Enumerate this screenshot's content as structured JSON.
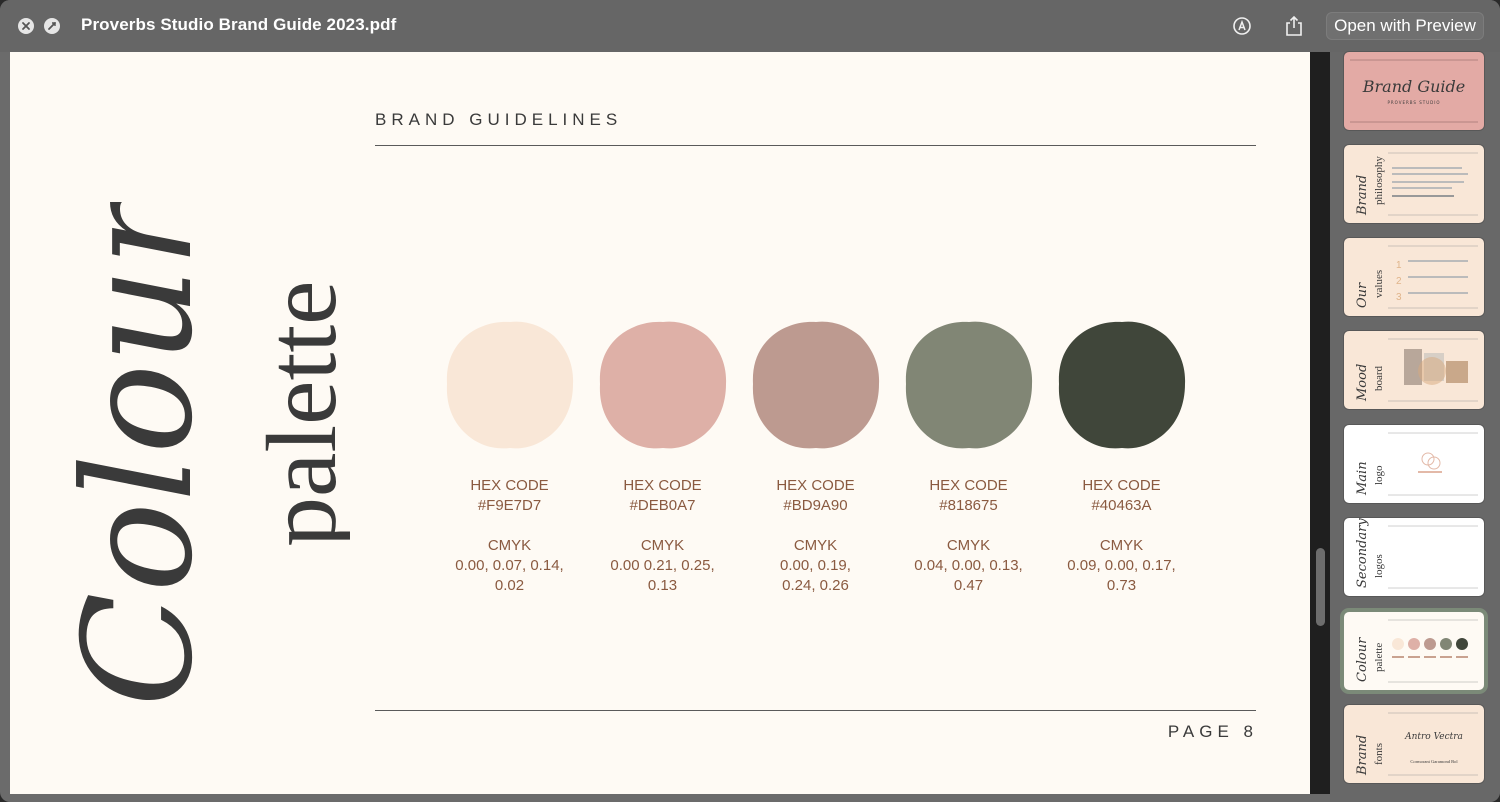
{
  "window": {
    "title": "Proverbs Studio Brand Guide 2023.pdf",
    "open_with_label": "Open with Preview"
  },
  "page": {
    "heading": "BRAND GUIDELINES",
    "title_script_word": "Colour",
    "title_serif_word": "palette",
    "page_number": "PAGE 8",
    "hex_label": "HEX CODE",
    "cmyk_label": "CMYK",
    "swatches": [
      {
        "hex": "#F9E7D7",
        "cmyk_line1": "0.00, 0.07, 0.14,",
        "cmyk_line2": "0.02",
        "color": "#F9E7D7"
      },
      {
        "hex": "#DEB0A7",
        "cmyk_line1": "0.00 0.21, 0.25,",
        "cmyk_line2": "0.13",
        "color": "#DEB0A7"
      },
      {
        "hex": "#BD9A90",
        "cmyk_line1": "0.00, 0.19,",
        "cmyk_line2": "0.24, 0.26",
        "color": "#BD9A90"
      },
      {
        "hex": "#818675",
        "cmyk_line1": "0.04, 0.00, 0.13,",
        "cmyk_line2": "0.47",
        "color": "#818675"
      },
      {
        "hex": "#40463A",
        "cmyk_line1": "0.09, 0.00, 0.17,",
        "cmyk_line2": "0.73",
        "color": "#40463A"
      }
    ]
  },
  "thumbnails": [
    {
      "script": "Brand Guide",
      "serif": "",
      "bg": "#e3aaa5"
    },
    {
      "script": "Brand",
      "serif": "philosophy",
      "bg": "#f9e7d7"
    },
    {
      "script": "Our",
      "serif": "values",
      "bg": "#f9e7d7"
    },
    {
      "script": "Mood",
      "serif": "board",
      "bg": "#f9e7d7"
    },
    {
      "script": "Main",
      "serif": "logo",
      "bg": "#ffffff"
    },
    {
      "script": "Secondary",
      "serif": "logos",
      "bg": "#ffffff"
    },
    {
      "script": "Colour",
      "serif": "palette",
      "bg": "#fefaf4"
    },
    {
      "script": "Brand",
      "serif": "fonts",
      "bg": "#f9e7d7"
    }
  ],
  "thumbnail_texts": {
    "t1_sub": "PROVERBS STUDIO",
    "t8_main_font": "Antro Vectra",
    "t8_comp_font": "Cormorant Garamond Bol"
  },
  "colors": {
    "accent_text": "#8a5a40",
    "page_bg": "#fefaf4",
    "chrome": "#666666"
  }
}
